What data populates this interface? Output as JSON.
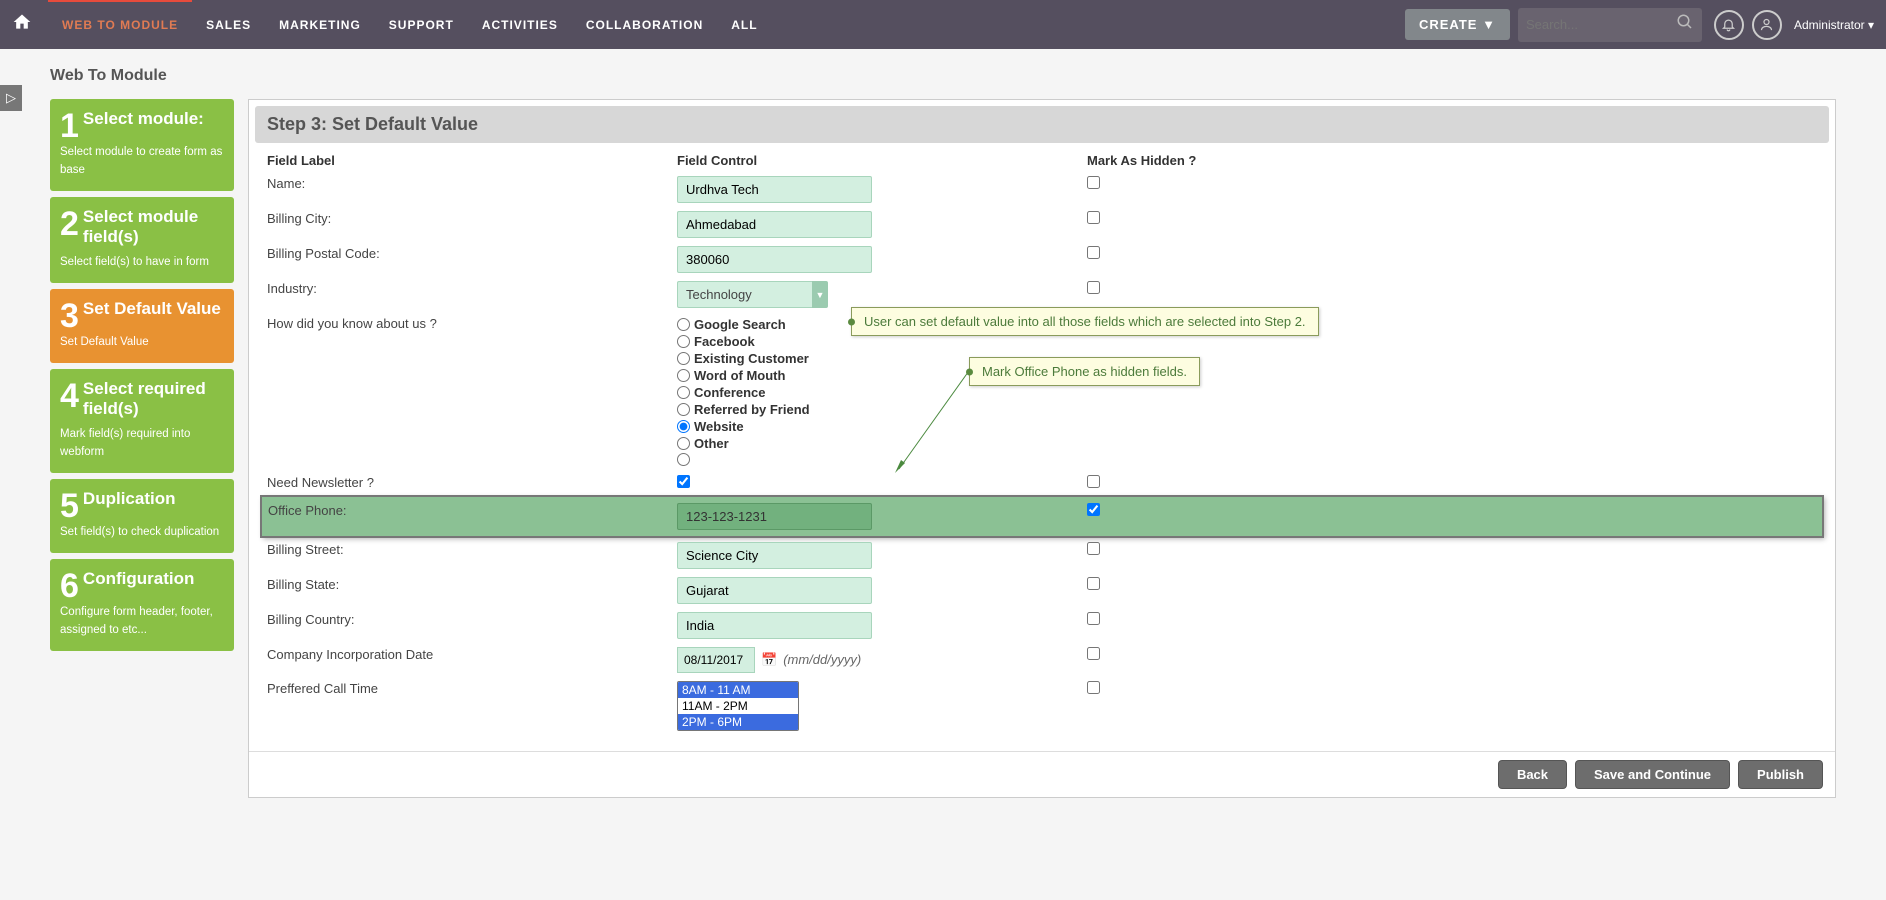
{
  "topbar": {
    "nav": [
      "WEB TO MODULE",
      "SALES",
      "MARKETING",
      "SUPPORT",
      "ACTIVITIES",
      "COLLABORATION",
      "ALL"
    ],
    "active_index": 0,
    "create_label": "CREATE ▼",
    "search_placeholder": "Search...",
    "admin_label": "Administrator"
  },
  "page_title": "Web To Module",
  "steps": [
    {
      "num": "1",
      "title": "Select module:",
      "desc": "Select module to create form as base"
    },
    {
      "num": "2",
      "title": "Select module field(s)",
      "desc": "Select field(s) to have in form"
    },
    {
      "num": "3",
      "title": "Set Default Value",
      "desc": "Set Default Value"
    },
    {
      "num": "4",
      "title": "Select required field(s)",
      "desc": "Mark field(s) required into webform"
    },
    {
      "num": "5",
      "title": "Duplication",
      "desc": "Set field(s) to check duplication"
    },
    {
      "num": "6",
      "title": "Configuration",
      "desc": "Configure form header, footer, assigned to etc..."
    }
  ],
  "active_step_index": 2,
  "step_header": "Step 3: Set Default Value",
  "table": {
    "headers": [
      "Field Label",
      "Field Control",
      "Mark As Hidden ?"
    ],
    "rows": [
      {
        "label": "Name:",
        "type": "text",
        "value": "Urdhva Tech",
        "hidden": false
      },
      {
        "label": "Billing City:",
        "type": "text",
        "value": "Ahmedabad",
        "hidden": false
      },
      {
        "label": "Billing Postal Code:",
        "type": "text",
        "value": "380060",
        "hidden": false
      },
      {
        "label": "Industry:",
        "type": "select",
        "value": "Technology",
        "hidden": false
      },
      {
        "label": "How did you know about us ?",
        "type": "radio",
        "options": [
          "Google Search",
          "Facebook",
          "Existing Customer",
          "Word of Mouth",
          "Conference",
          "Referred by Friend",
          "Website",
          "Other",
          ""
        ],
        "selected": "Website",
        "hidden": false
      },
      {
        "label": "Need Newsletter ?",
        "type": "checkbox",
        "checked": true,
        "hidden": false
      },
      {
        "label": "Office Phone:",
        "type": "text",
        "value": "123-123-1231",
        "hidden": true,
        "highlight": true
      },
      {
        "label": "Billing Street:",
        "type": "text",
        "value": "Science City",
        "hidden": false
      },
      {
        "label": "Billing State:",
        "type": "text",
        "value": "Gujarat",
        "hidden": false
      },
      {
        "label": "Billing Country:",
        "type": "text",
        "value": "India",
        "hidden": false
      },
      {
        "label": "Company Incorporation Date",
        "type": "date",
        "value": "08/11/2017",
        "format": "(mm/dd/yyyy)",
        "hidden": false
      },
      {
        "label": "Preffered Call Time",
        "type": "multi",
        "options": [
          "8AM - 11 AM",
          "11AM - 2PM",
          "2PM - 6PM"
        ],
        "selected": [
          "8AM - 11 AM",
          "2PM - 6PM"
        ],
        "hidden": false
      }
    ]
  },
  "callouts": {
    "c1": "User can set default value into all those fields which are selected into Step 2.",
    "c2": "Mark Office Phone as hidden fields."
  },
  "buttons": {
    "back": "Back",
    "save": "Save and Continue",
    "publish": "Publish"
  }
}
